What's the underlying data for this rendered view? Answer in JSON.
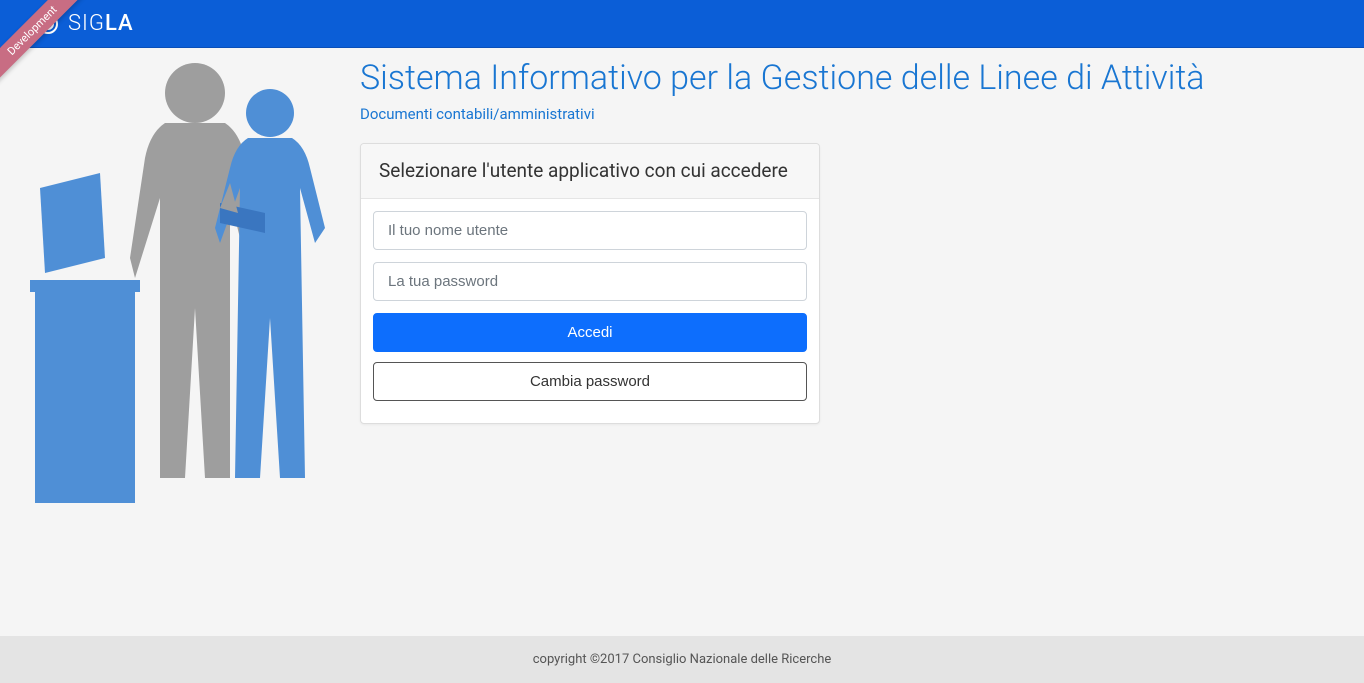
{
  "header": {
    "brand_text_1": "SIG",
    "brand_text_2": "LA",
    "ribbon_label": "Development"
  },
  "main": {
    "title": "Sistema Informativo per la Gestione delle Linee di Attività",
    "subtitle": "Documenti contabili/amministrativi"
  },
  "login": {
    "heading": "Selezionare l'utente applicativo con cui accedere",
    "username_placeholder": "Il tuo nome utente",
    "password_placeholder": "La tua password",
    "submit_label": "Accedi",
    "change_password_label": "Cambia password"
  },
  "footer": {
    "copyright": "copyright ©2017 Consiglio Nazionale delle Ricerche"
  }
}
